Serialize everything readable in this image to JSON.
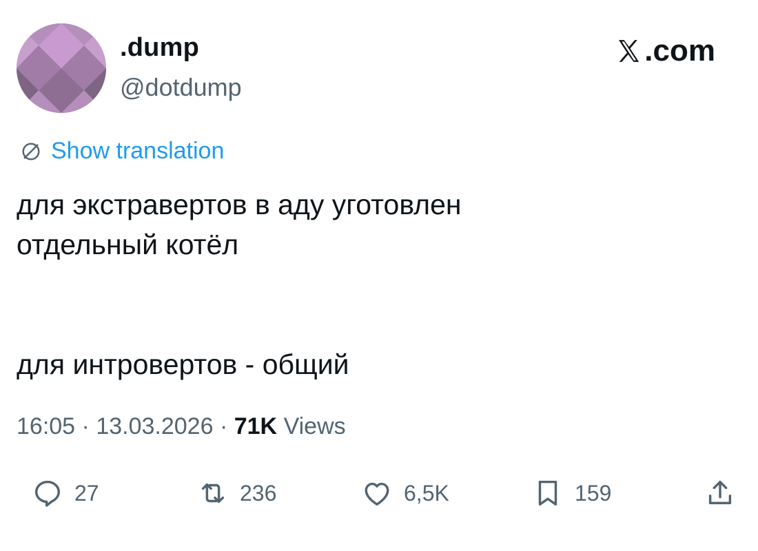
{
  "author": {
    "display_name": ".dump",
    "handle": "@dotdump",
    "avatar_icon": "diamond-pattern-avatar",
    "avatar_colors": [
      "#d6a8dc",
      "#8e6f93",
      "#6f5b73"
    ]
  },
  "brand": {
    "logo_icon": "x-logo-icon",
    "suffix": ".com"
  },
  "translation": {
    "icon": "globe-icon",
    "label": "Show translation"
  },
  "tweet": {
    "line1": "для экстравертов в аду уготовлен",
    "line2": "отдельный котёл",
    "line3": "для интровертов - общий"
  },
  "meta": {
    "time": "16:05",
    "separator": "·",
    "date": "13.03.2026",
    "views_count": "71K",
    "views_label": "Views"
  },
  "actions": {
    "replies": "27",
    "reposts": "236",
    "likes": "6,5K",
    "bookmarks": "159"
  },
  "colors": {
    "text": "#0f1419",
    "secondary": "#536471",
    "link": "#1d9bf0"
  }
}
